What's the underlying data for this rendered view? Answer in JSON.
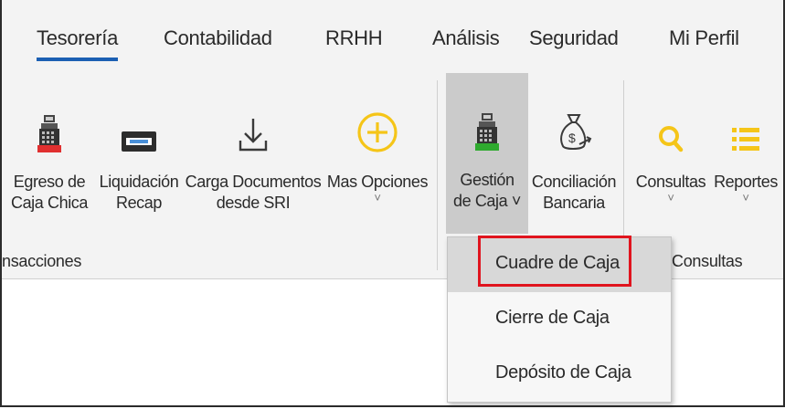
{
  "tabs": [
    {
      "label": "Tesorería",
      "active": true
    },
    {
      "label": "Contabilidad"
    },
    {
      "label": "RRHH"
    },
    {
      "label": "Análisis"
    },
    {
      "label": "Seguridad"
    },
    {
      "label": "Mi Perfil"
    }
  ],
  "ribbon": {
    "buttons": [
      {
        "line1": "Egreso de",
        "line2": "Caja Chica",
        "icon": "cash-register-icon"
      },
      {
        "line1": "Liquidación",
        "line2": "Recap",
        "icon": "card-icon"
      },
      {
        "line1": "Carga Documentos",
        "line2": "desde SRI",
        "icon": "download-icon"
      },
      {
        "line1": "Mas Opciones",
        "chevron": "˅",
        "icon": "plus-circle-icon"
      },
      {
        "line1": "Gestión",
        "line2": "de Caja ˅",
        "icon": "cash-register-icon"
      },
      {
        "line1": "Conciliación",
        "line2": "Bancaria",
        "icon": "money-bag-icon"
      },
      {
        "line1": "Consultas",
        "chevron": "˅",
        "icon": "search-icon"
      },
      {
        "line1": "Reportes",
        "chevron": "˅",
        "icon": "list-icon"
      }
    ],
    "groups": [
      {
        "label": "nsacciones"
      },
      {
        "label": "Consultas"
      }
    ]
  },
  "dropdown": {
    "items": [
      {
        "label": "Cuadre de Caja"
      },
      {
        "label": "Cierre de Caja"
      },
      {
        "label": "Depósito de Caja"
      }
    ]
  },
  "colors": {
    "accent": "#1b5fb3",
    "highlight": "#e0141e",
    "yellow": "#f5c518"
  }
}
